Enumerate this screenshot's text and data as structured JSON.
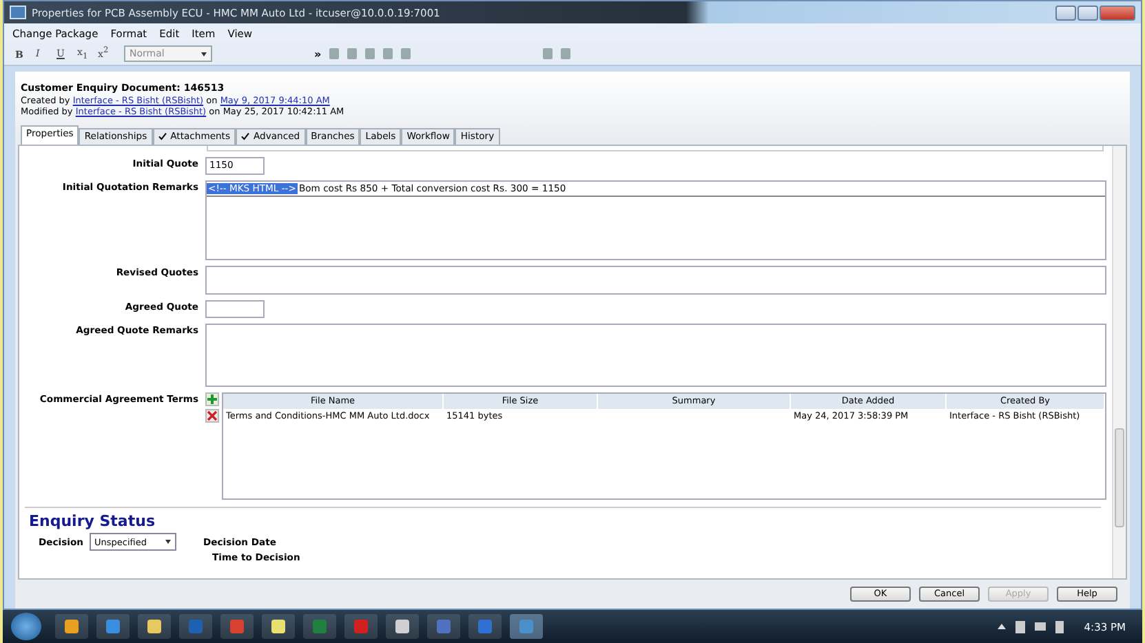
{
  "window": {
    "title": "Properties for PCB Assembly ECU - HMC MM Auto Ltd - itcuser@10.0.0.19:7001"
  },
  "menu": [
    "Change Package",
    "Format",
    "Edit",
    "Item",
    "View"
  ],
  "toolbar": {
    "format_buttons": [
      "B",
      "I",
      "U",
      "x$_{1}$",
      "x$^{2}$"
    ],
    "style_select": "Normal",
    "overflow": "»"
  },
  "header": {
    "title": "Customer Enquiry Document:  146513",
    "created": {
      "prefix": "Created by",
      "user": "Interface - RS Bisht (RSBisht)",
      "on": "on",
      "date": "May 9, 2017 9:44:10 AM"
    },
    "modified": {
      "prefix": "Modified by",
      "user": "Interface - RS Bisht (RSBisht)",
      "on": "on May 25, 2017 10:42:11 AM"
    }
  },
  "tabs": [
    {
      "label": "Properties",
      "selected": true,
      "checked": false
    },
    {
      "label": "Relationships",
      "selected": false,
      "checked": false
    },
    {
      "label": "Attachments",
      "selected": false,
      "checked": true
    },
    {
      "label": "Advanced",
      "selected": false,
      "checked": true
    },
    {
      "label": "Branches",
      "selected": false,
      "checked": false
    },
    {
      "label": "Labels",
      "selected": false,
      "checked": false
    },
    {
      "label": "Workflow",
      "selected": false,
      "checked": false
    },
    {
      "label": "History",
      "selected": false,
      "checked": false
    }
  ],
  "fields": [
    {
      "kind": "short",
      "label": "Initial Quote",
      "value": "1150"
    },
    {
      "kind": "richtext",
      "label": "Initial Quotation Remarks",
      "selected_text": "<!-- MKS HTML -->",
      "value": "Bom cost Rs 850 + Total conversion cost Rs. 300 = 1150"
    },
    {
      "kind": "line",
      "label": "Revised Quotes"
    },
    {
      "kind": "short",
      "label": "Agreed Quote"
    },
    {
      "kind": "area",
      "label": "Agreed Quote Remarks"
    }
  ],
  "attachments": {
    "label": "Commercial Agreement Terms",
    "columns": [
      "File Name",
      "File Size",
      "Summary",
      "Date Added",
      "Created By"
    ],
    "rows": [
      [
        "Terms and Conditions-HMC MM Auto Ltd.docx",
        "15141 bytes",
        "",
        "May 24, 2017 3:58:39 PM",
        "Interface - RS Bisht (RSBisht)"
      ]
    ]
  },
  "enquiry_status": {
    "heading": "Enquiry Status",
    "decision_label": "Decision",
    "decision_value": "Unspecified",
    "decision_date_label": "Decision Date",
    "time_label": "Time to Decision"
  },
  "buttons": [
    {
      "label": "OK",
      "disabled": false
    },
    {
      "label": "Cancel",
      "disabled": false
    },
    {
      "label": "Apply",
      "disabled": true
    },
    {
      "label": "Help",
      "disabled": false
    }
  ],
  "taskbar": {
    "apps": [
      {
        "kind": "media",
        "active": false
      },
      {
        "kind": "ie",
        "active": false
      },
      {
        "kind": "folder",
        "active": false
      },
      {
        "kind": "outlook",
        "active": false
      },
      {
        "kind": "chrome",
        "active": false
      },
      {
        "kind": "notes",
        "active": false
      },
      {
        "kind": "excel",
        "active": false
      },
      {
        "kind": "acrobat",
        "active": false
      },
      {
        "kind": "s",
        "active": false
      },
      {
        "kind": "network",
        "active": false
      },
      {
        "kind": "lync",
        "active": false
      },
      {
        "kind": "ptc",
        "active": true
      }
    ],
    "clock": "4:33 PM"
  }
}
